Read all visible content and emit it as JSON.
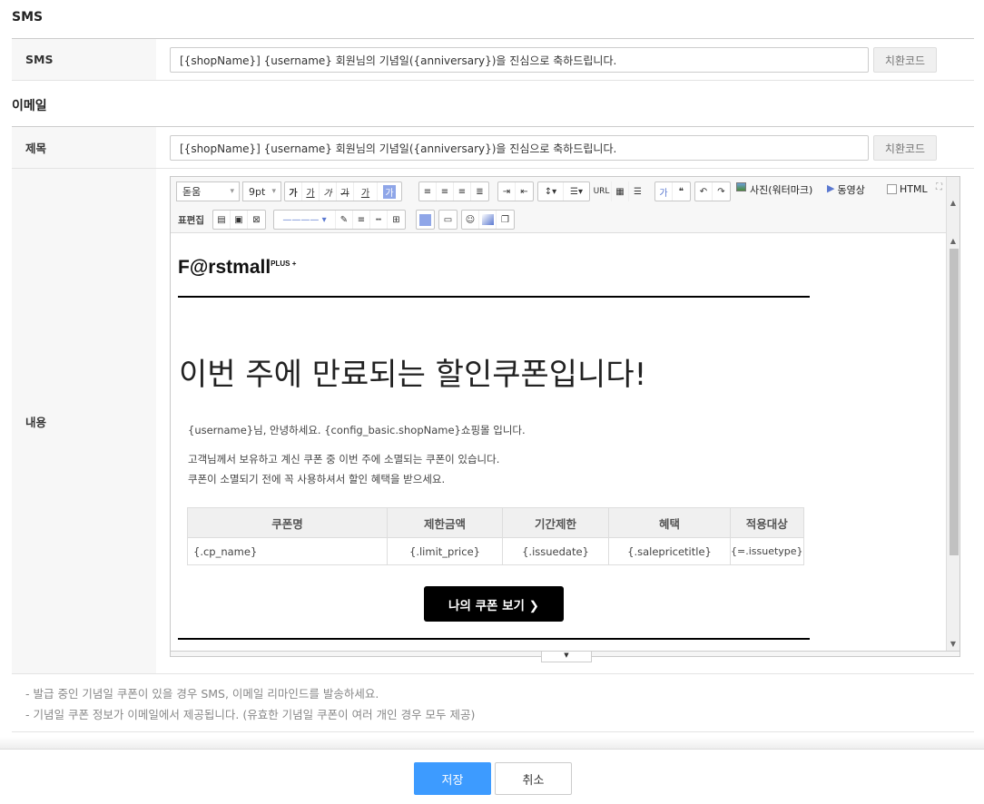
{
  "sms_section": {
    "title": "SMS",
    "label": "SMS",
    "value": "[{shopName}] {username} 회원님의 기념일({anniversary})을 진심으로 축하드립니다.",
    "code_button": "치환코드"
  },
  "email_section": {
    "title": "이메일",
    "subject_label": "제목",
    "subject_value": "[{shopName}] {username} 회원님의 기념일({anniversary})을 진심으로 축하드립니다.",
    "code_button": "치환코드",
    "content_label": "내용"
  },
  "editor": {
    "font_family": "돋움",
    "font_size": "9pt",
    "format_buttons": [
      "가",
      "가",
      "가",
      "가",
      "가"
    ],
    "highlight": "가",
    "url": "URL",
    "photo": "사진(워터마크)",
    "video": "동영상",
    "html_label": "HTML",
    "table_edit": "표편집",
    "content": {
      "logo": "F@rstmall",
      "logo_sup": "PLUS +",
      "heading": "이번 주에 만료되는 할인쿠폰입니다!",
      "greeting": "{username}님, 안녕하세요. {config_basic.shopName}쇼핑몰 입니다.",
      "line1": "고객님께서 보유하고 계신 쿠폰 중 이번 주에 소멸되는 쿠폰이 있습니다.",
      "line2": "쿠폰이 소멸되기 전에 꼭 사용하셔서 할인 혜택을 받으세요.",
      "table": {
        "headers": [
          "쿠폰명",
          "제한금액",
          "기간제한",
          "혜택",
          "적용대상"
        ],
        "row": [
          "{.cp_name}",
          "{.limit_price}",
          "{.issuedate}",
          "{.salepricetitle}",
          "{=.issuetype}"
        ]
      },
      "cta": "나의 쿠폰 보기 ❯"
    }
  },
  "notes": [
    "-  발급 중인 기념일 쿠폰이 있을 경우 SMS, 이메일 리마인드를 발송하세요.",
    "-  기념일 쿠폰 정보가 이메일에서 제공됩니다. (유효한 기념일 쿠폰이 여러 개인 경우 모두 제공)"
  ],
  "footer": {
    "save": "저장",
    "cancel": "취소"
  },
  "colors": {
    "save_button": "#3d9bff",
    "cta_button": "#000000"
  }
}
